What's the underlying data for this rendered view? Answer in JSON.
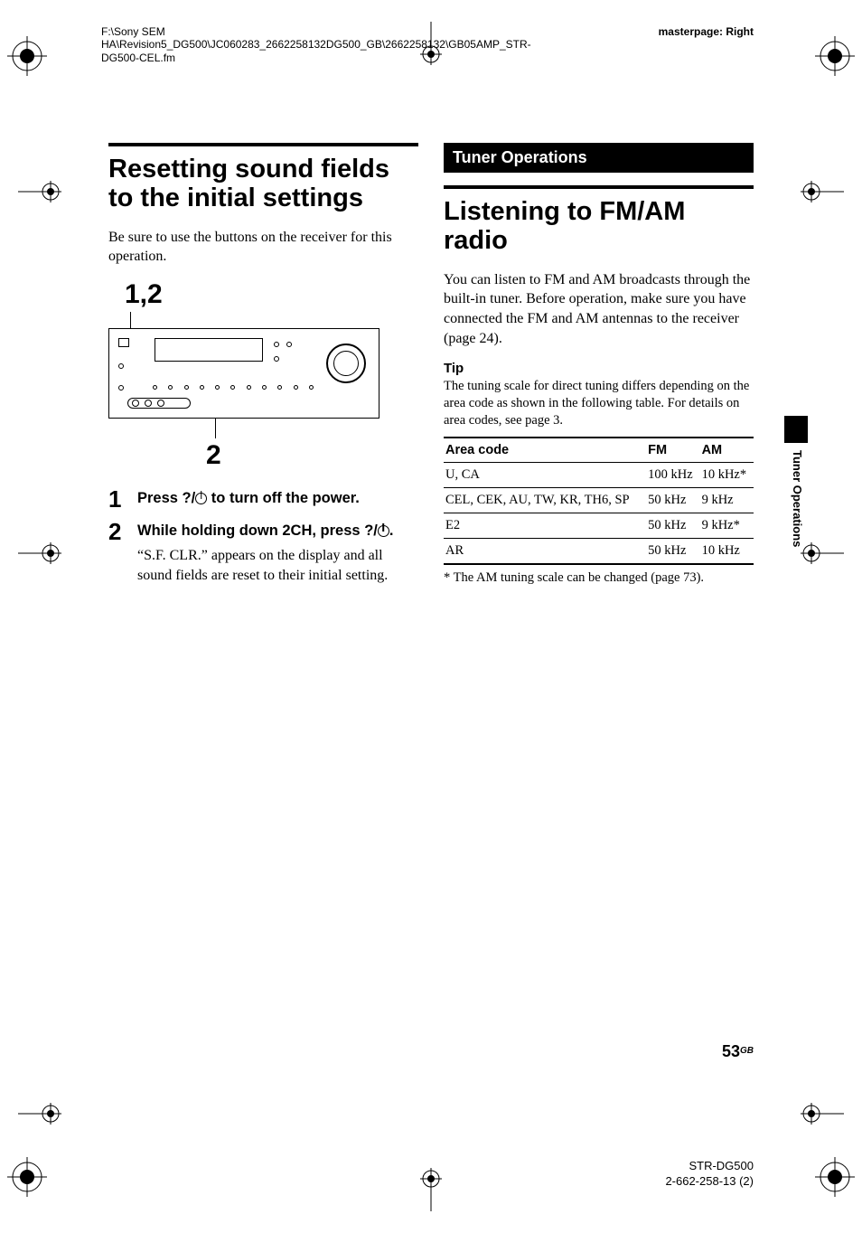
{
  "header": {
    "path": "F:\\Sony SEM HA\\Revision5_DG500\\JC060283_2662258132DG500_GB\\2662258132\\GB05AMP_STR-DG500-CEL.fm",
    "masterpage": "masterpage: Right"
  },
  "left": {
    "title": "Resetting sound fields to the initial settings",
    "intro": "Be sure to use the buttons on the receiver for this operation.",
    "callout_top": "1,2",
    "callout_bottom": "2",
    "steps": [
      {
        "num": "1",
        "title_before": "Press ",
        "title_io": "?/",
        "title_after": " to turn off the power."
      },
      {
        "num": "2",
        "title_before": "While holding down 2CH, press ",
        "title_io": "?/",
        "title_after": ".",
        "desc": "“S.F. CLR.” appears on the display and all sound fields are reset to their initial setting."
      }
    ]
  },
  "right": {
    "section": "Tuner Operations",
    "title": "Listening to FM/AM radio",
    "intro": "You can listen to FM and AM broadcasts through the built-in tuner. Before operation, make sure you have connected the FM and AM antennas to the receiver (page 24).",
    "tip_head": "Tip",
    "tip_text": "The tuning scale for direct tuning differs depending on the area code as shown in the following table. For details on area codes, see page 3.",
    "table": {
      "headers": [
        "Area code",
        "FM",
        "AM"
      ],
      "rows": [
        [
          "U, CA",
          "100 kHz",
          "10 kHz*"
        ],
        [
          "CEL, CEK, AU, TW, KR, TH6, SP",
          "50 kHz",
          "9 kHz"
        ],
        [
          "E2",
          "50 kHz",
          "9 kHz*"
        ],
        [
          "AR",
          "50 kHz",
          "10 kHz"
        ]
      ]
    },
    "footnote": "* The AM tuning scale can be changed (page 73)."
  },
  "side_label": "Tuner Operations",
  "footer": {
    "page": "53",
    "suffix": "GB",
    "model": "STR-DG500",
    "code": "2-662-258-13 (2)"
  }
}
